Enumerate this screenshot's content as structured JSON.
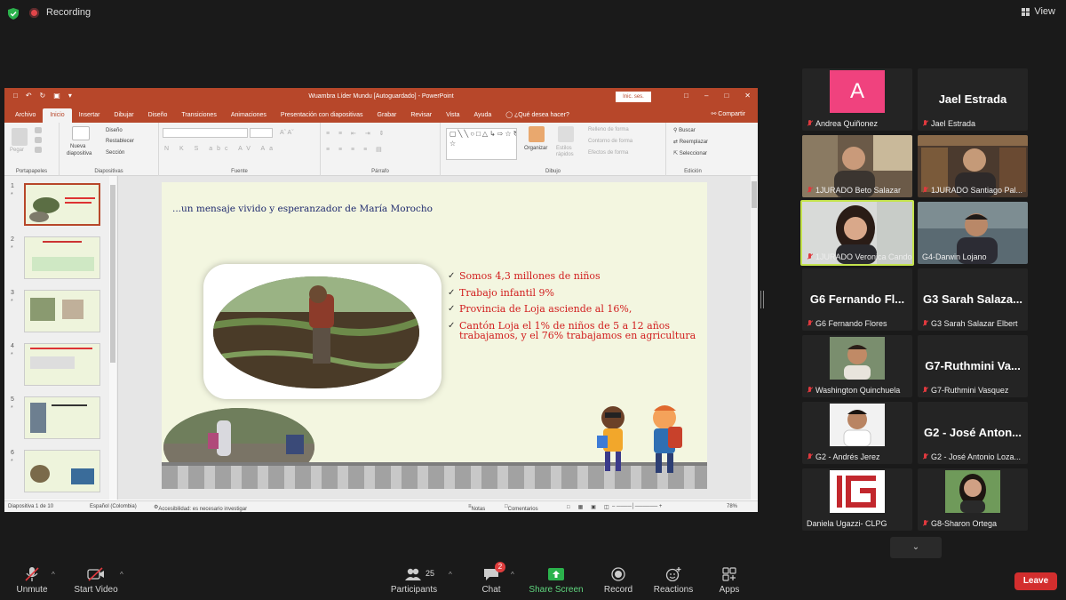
{
  "topbar": {
    "recording_label": "Recording",
    "view_label": "View"
  },
  "ppt": {
    "doc_title": "Wuambra Líder Mundu [Autoguardado]  -  PowerPoint",
    "signin": "Inic. ses.",
    "tabs": [
      "Archivo",
      "Inicio",
      "Insertar",
      "Dibujar",
      "Diseño",
      "Transiciones",
      "Animaciones",
      "Presentación con diapositivas",
      "Grabar",
      "Revisar",
      "Vista",
      "Ayuda",
      "¿Qué desea hacer?"
    ],
    "share": "Compartir",
    "ribbon": {
      "paste": "Pegar",
      "portapapeles": "Portapapeles",
      "nueva": "Nueva",
      "diapositiva": "diapositiva",
      "diseno": "Diseño",
      "restablecer": "Restablecer",
      "seccion": "Sección",
      "diapositivas": "Diapositivas",
      "fuente": "Fuente",
      "parrafo": "Párrafo",
      "organizar": "Organizar",
      "estilos": "Estilos",
      "rapidos": "rápidos",
      "relleno": "Relleno de forma",
      "contorno": "Contorno de forma",
      "efectos": "Efectos de forma",
      "dibujo": "Dibujo",
      "buscar": "Buscar",
      "reemplazar": "Reemplazar",
      "seleccionar": "Seleccionar",
      "edicion": "Edición"
    },
    "thumbs": [
      {
        "num": "1",
        "star": "*"
      },
      {
        "num": "2",
        "star": "*"
      },
      {
        "num": "3",
        "star": "*"
      },
      {
        "num": "4",
        "star": "*"
      },
      {
        "num": "5",
        "star": "*"
      },
      {
        "num": "6",
        "star": "*"
      }
    ],
    "slide": {
      "heading": "...un mensaje vivido y esperanzador de María Morocho",
      "bullets": [
        "Somos 4,3 millones de niños",
        "Trabajo infantil 9%",
        "Provincia de Loja asciende al 16%,",
        "Cantón Loja el 1% de niños de 5 a 12 años trabajamos, y  el 76% trabajamos en agricultura"
      ]
    },
    "status": {
      "slide_of": "Diapositiva 1 de 10",
      "language": "Español (Colombia)",
      "accessibility": "Accesibilidad: es necesario investigar",
      "notes": "Notas",
      "comments": "Comentarios",
      "zoom": "78%"
    }
  },
  "participants": [
    {
      "name": "Andrea Quiñonez",
      "initial": "A",
      "type": "avatar"
    },
    {
      "name": "Jael Estrada",
      "display": "Jael Estrada",
      "type": "text"
    },
    {
      "name": "1JURADO Beto Salazar",
      "type": "video"
    },
    {
      "name": "1JURADO Santiago Pal...",
      "type": "video"
    },
    {
      "name": "1JURADO Veronica Cando",
      "type": "video"
    },
    {
      "name": "G4-Darwin Lojano",
      "type": "video"
    },
    {
      "name": "G6 Fernando Flores",
      "display": "G6 Fernando Fl...",
      "type": "text"
    },
    {
      "name": "G3 Sarah Salazar Elbert",
      "display": "G3 Sarah Salaza...",
      "type": "text"
    },
    {
      "name": "Washington Quinchuela",
      "type": "photo"
    },
    {
      "name": "G7-Ruthmini Vasquez",
      "display": "G7-Ruthmini  Va...",
      "type": "text"
    },
    {
      "name": "G2 - Andrés Jerez",
      "type": "photo"
    },
    {
      "name": "G2 - José Antonio Loza...",
      "display": "G2 - José Anton...",
      "type": "text"
    },
    {
      "name": "Daniela Ugazzi- CLPG",
      "type": "logo"
    },
    {
      "name": "G8-Sharon Ortega",
      "type": "photo"
    }
  ],
  "toolbar": {
    "unmute": "Unmute",
    "start_video": "Start Video",
    "participants": "Participants",
    "participants_count": "25",
    "chat": "Chat",
    "chat_badge": "2",
    "share": "Share Screen",
    "record": "Record",
    "reactions": "Reactions",
    "apps": "Apps",
    "leave": "Leave"
  }
}
